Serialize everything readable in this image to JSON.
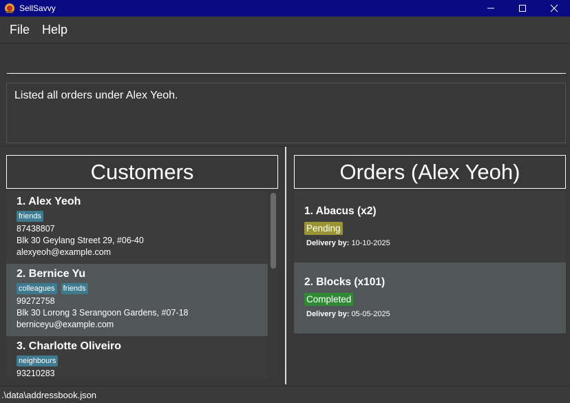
{
  "window": {
    "title": "SellSavvy",
    "controls": [
      "minimize",
      "maximize",
      "close"
    ]
  },
  "menu": {
    "items": [
      "File",
      "Help"
    ]
  },
  "command": {
    "value": ""
  },
  "result": {
    "message": "Listed all orders under Alex Yeoh."
  },
  "customers": {
    "title": "Customers",
    "items": [
      {
        "name": "1. Alex Yeoh",
        "tags": [
          "friends"
        ],
        "phone": "87438807",
        "address": "Blk 30 Geylang Street 29, #06-40",
        "email": "alexyeoh@example.com"
      },
      {
        "name": "2. Bernice Yu",
        "tags": [
          "colleagues",
          "friends"
        ],
        "phone": "99272758",
        "address": "Blk 30 Lorong 3 Serangoon Gardens, #07-18",
        "email": "berniceyu@example.com"
      },
      {
        "name": "3. Charlotte Oliveiro",
        "tags": [
          "neighbours"
        ],
        "phone": "93210283",
        "address": "",
        "email": ""
      }
    ]
  },
  "orders": {
    "title": "Orders (Alex Yeoh)",
    "items": [
      {
        "name": "1. Abacus (x2)",
        "status": "Pending",
        "delivery_label": "Delivery by:",
        "delivery_date": "10-10-2025"
      },
      {
        "name": "2. Blocks (x101)",
        "status": "Completed",
        "delivery_label": "Delivery by:",
        "delivery_date": "05-05-2025"
      }
    ]
  },
  "status_bar": {
    "path": ".\\data\\addressbook.json"
  },
  "colors": {
    "titlebar": "#0a0a82",
    "background": "#383838",
    "tag": "#3e7b91",
    "pending": "#9a9433",
    "completed": "#2f8a33"
  }
}
